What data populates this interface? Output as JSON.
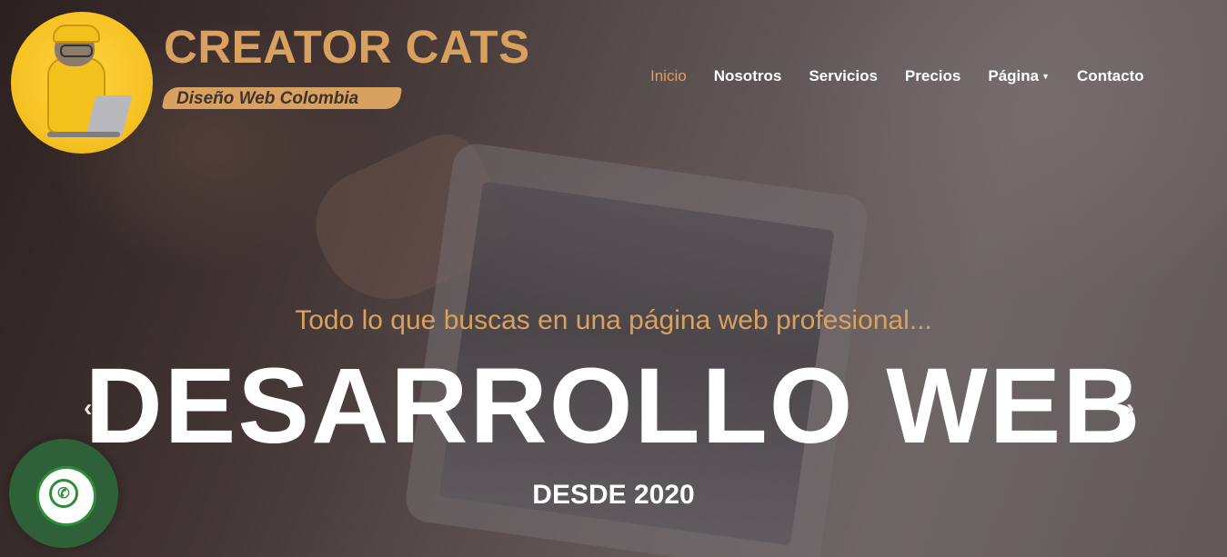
{
  "brand": {
    "name": "CREATOR CATS",
    "tagline": "Diseño Web Colombia",
    "logo_icon": "cat-developer-logo"
  },
  "nav": {
    "items": [
      {
        "label": "Inicio",
        "active": true
      },
      {
        "label": "Nosotros"
      },
      {
        "label": "Servicios"
      },
      {
        "label": "Precios"
      },
      {
        "label": "Página",
        "dropdown": true
      },
      {
        "label": "Contacto"
      }
    ]
  },
  "hero": {
    "subtitle": "Todo lo que buscas en una página web profesional...",
    "title": "DESARROLLO WEB",
    "since": "DESDE 2020",
    "prev_icon": "chevron-left-icon",
    "next_icon": "chevron-right-icon"
  },
  "whatsapp": {
    "icon": "whatsapp-icon"
  },
  "colors": {
    "accent": "#d9a15f",
    "whatsapp_green": "#2f8d3a"
  }
}
